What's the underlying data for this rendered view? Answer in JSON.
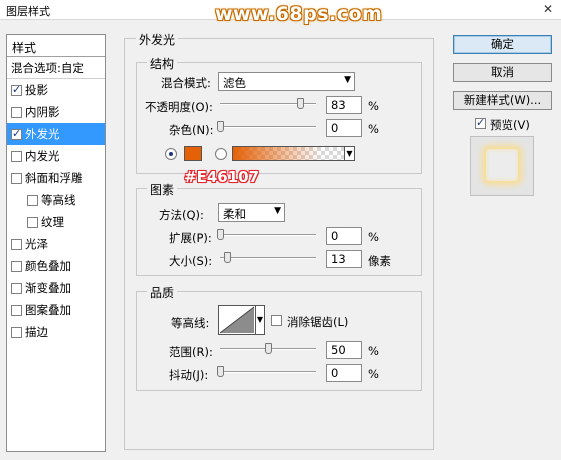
{
  "window": {
    "title": "图层样式",
    "close_glyph": "✕",
    "watermark": "www.68ps.com"
  },
  "styles": {
    "header": "样式",
    "blend_options": "混合选项:自定",
    "items": [
      {
        "label": "投影",
        "checked": true,
        "indent": false,
        "selected": false
      },
      {
        "label": "内阴影",
        "checked": false,
        "indent": false,
        "selected": false
      },
      {
        "label": "外发光",
        "checked": true,
        "indent": false,
        "selected": true
      },
      {
        "label": "内发光",
        "checked": false,
        "indent": false,
        "selected": false
      },
      {
        "label": "斜面和浮雕",
        "checked": false,
        "indent": false,
        "selected": false
      },
      {
        "label": "等高线",
        "checked": false,
        "indent": true,
        "selected": false
      },
      {
        "label": "纹理",
        "checked": false,
        "indent": true,
        "selected": false
      },
      {
        "label": "光泽",
        "checked": false,
        "indent": false,
        "selected": false
      },
      {
        "label": "颜色叠加",
        "checked": false,
        "indent": false,
        "selected": false
      },
      {
        "label": "渐变叠加",
        "checked": false,
        "indent": false,
        "selected": false
      },
      {
        "label": "图案叠加",
        "checked": false,
        "indent": false,
        "selected": false
      },
      {
        "label": "描边",
        "checked": false,
        "indent": false,
        "selected": false
      }
    ]
  },
  "outer_glow": {
    "title": "外发光",
    "structure": {
      "title": "结构",
      "blend_mode_label": "混合模式:",
      "blend_mode_value": "滤色",
      "opacity_label": "不透明度(O):",
      "opacity_value": "83",
      "opacity_unit": "%",
      "opacity_fraction": 0.83,
      "noise_label": "杂色(N):",
      "noise_value": "0",
      "noise_unit": "%",
      "noise_fraction": 0.0,
      "glow_color": "#e46107"
    },
    "annotation": "#E46107",
    "elements": {
      "title": "图素",
      "method_label": "方法(Q):",
      "method_value": "柔和",
      "spread_label": "扩展(P):",
      "spread_value": "0",
      "spread_unit": "%",
      "spread_fraction": 0.0,
      "size_label": "大小(S):",
      "size_value": "13",
      "size_unit": "像素",
      "size_fraction": 0.07
    },
    "quality": {
      "title": "品质",
      "contour_label": "等高线:",
      "anti_alias_label": "消除锯齿(L)",
      "anti_alias_checked": false,
      "range_label": "范围(R):",
      "range_value": "50",
      "range_unit": "%",
      "range_fraction": 0.5,
      "jitter_label": "抖动(J):",
      "jitter_value": "0",
      "jitter_unit": "%",
      "jitter_fraction": 0.0
    }
  },
  "buttons": {
    "ok": "确定",
    "cancel": "取消",
    "new_style": "新建样式(W)...",
    "preview_label": "预览(V)",
    "preview_checked": true
  }
}
